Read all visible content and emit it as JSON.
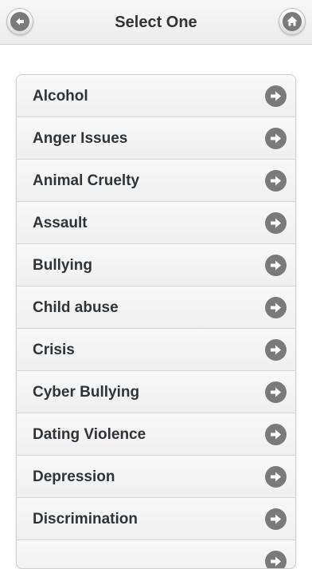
{
  "header": {
    "title": "Select One",
    "back_icon": "back-arrow-icon",
    "home_icon": "home-icon"
  },
  "list": {
    "items": [
      {
        "label": "Alcohol"
      },
      {
        "label": "Anger Issues"
      },
      {
        "label": "Animal Cruelty"
      },
      {
        "label": "Assault"
      },
      {
        "label": "Bullying"
      },
      {
        "label": "Child abuse"
      },
      {
        "label": "Crisis"
      },
      {
        "label": "Cyber Bullying"
      },
      {
        "label": "Dating Violence"
      },
      {
        "label": "Depression"
      },
      {
        "label": "Discrimination"
      },
      {
        "label": ""
      }
    ]
  },
  "colors": {
    "text": "#2f3439",
    "icon_gray": "#7a7a7a",
    "header_bg": "#ececec"
  }
}
